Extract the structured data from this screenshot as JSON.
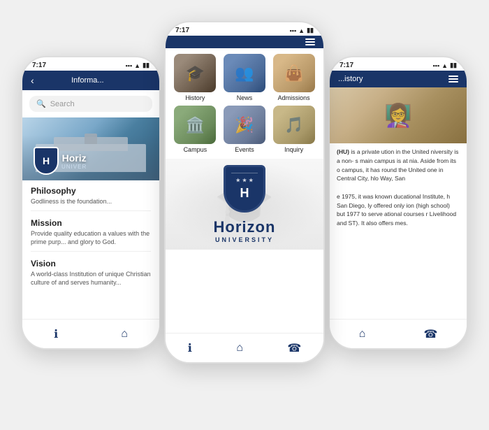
{
  "app": {
    "name": "Horizon University",
    "time": "7:17"
  },
  "left_phone": {
    "status_time": "7:17",
    "nav_title": "Informa...",
    "search_placeholder": "Search",
    "campus_name": "Horiz",
    "campus_sub": "UNIVER",
    "sections": [
      {
        "title": "Philosophy",
        "text": "Godliness is the foundation..."
      },
      {
        "title": "Mission",
        "text": "Provide quality education a values with the prime purp... and glory to God."
      },
      {
        "title": "Vision",
        "text": "A world-class Institution of unique Christian culture of and serves humanity..."
      }
    ],
    "bottom_nav": [
      "ℹ",
      "⌂"
    ]
  },
  "center_phone": {
    "status_time": "7:17",
    "grid_items": [
      {
        "label": "History",
        "fig": "fig-grad-1"
      },
      {
        "label": "News",
        "fig": "fig-grad-2"
      },
      {
        "label": "Admissions",
        "fig": "fig-grad-3"
      },
      {
        "label": "Campus",
        "fig": "fig-grad-4"
      },
      {
        "label": "Events",
        "fig": "fig-grad-5"
      },
      {
        "label": "Inquiry",
        "fig": "fig-grad-6"
      }
    ],
    "logo_letter": "H",
    "logo_title": "Horizon",
    "logo_sub": "UNIVERSITY",
    "bottom_nav": [
      "ℹ",
      "⌂",
      "☎"
    ]
  },
  "right_phone": {
    "status_time": "7:17",
    "nav_title": "...istory",
    "content": "(HU) is a private ution in the United niversity is a non- s main campus is at nia. Aside from its o campus, it has round the United one in Central City, hlo Way, San\n\ne 1975, it was known ducational Institute, h San Diego, ly offered only ion (high school) but 1977 to serve ational courses r Livelihood and ST). It also offers mes.",
    "aside_text": "Aside from its",
    "bottom_nav": [
      "⌂",
      "☎"
    ]
  }
}
